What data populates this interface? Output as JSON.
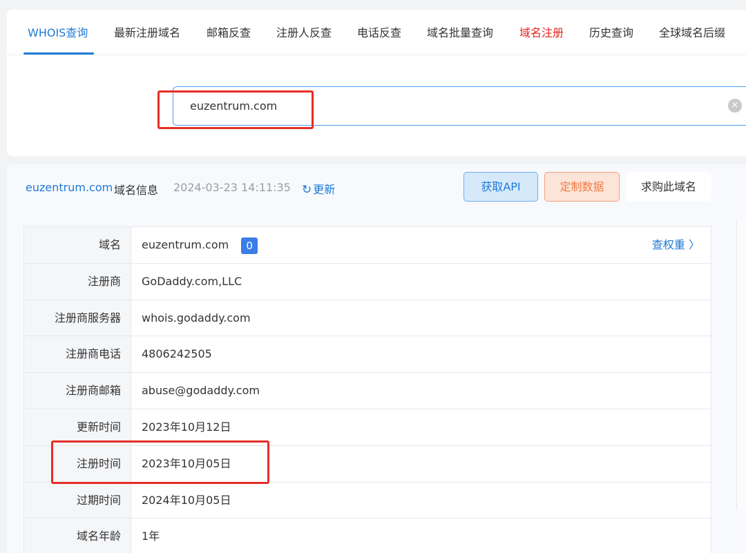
{
  "tabs": [
    {
      "label": "WHOIS查询"
    },
    {
      "label": "最新注册域名"
    },
    {
      "label": "邮箱反查"
    },
    {
      "label": "注册人反查"
    },
    {
      "label": "电话反查"
    },
    {
      "label": "域名批量查询"
    },
    {
      "label": "域名注册"
    },
    {
      "label": "历史查询"
    },
    {
      "label": "全球域名后缀"
    }
  ],
  "search": {
    "value": "euzentrum.com",
    "clear_icon": "×"
  },
  "header": {
    "domain": "euzentrum.com",
    "label": "域名信息",
    "timestamp": "2024-03-23 14:11:35",
    "refresh_icon": "↻",
    "refresh_label": "更新",
    "api_button": "获取API",
    "custom_button": "定制数据",
    "buy_button": "求购此域名"
  },
  "rows": [
    {
      "label": "域名",
      "value": "euzentrum.com",
      "badge": "0",
      "link": "查权重 〉"
    },
    {
      "label": "注册商",
      "value": "GoDaddy.com,LLC"
    },
    {
      "label": "注册商服务器",
      "value": "whois.godaddy.com"
    },
    {
      "label": "注册商电话",
      "value": "4806242505"
    },
    {
      "label": "注册商邮箱",
      "value": "abuse@godaddy.com"
    },
    {
      "label": "更新时间",
      "value": "2023年10月12日"
    },
    {
      "label": "注册时间",
      "value": "2023年10月05日"
    },
    {
      "label": "过期时间",
      "value": "2024年10月05日"
    },
    {
      "label": "域名年龄",
      "value": "1年"
    }
  ],
  "colors": {
    "accent": "#1e7ad6",
    "highlight_red": "#e62d26",
    "red_tab": "#e8241c"
  }
}
